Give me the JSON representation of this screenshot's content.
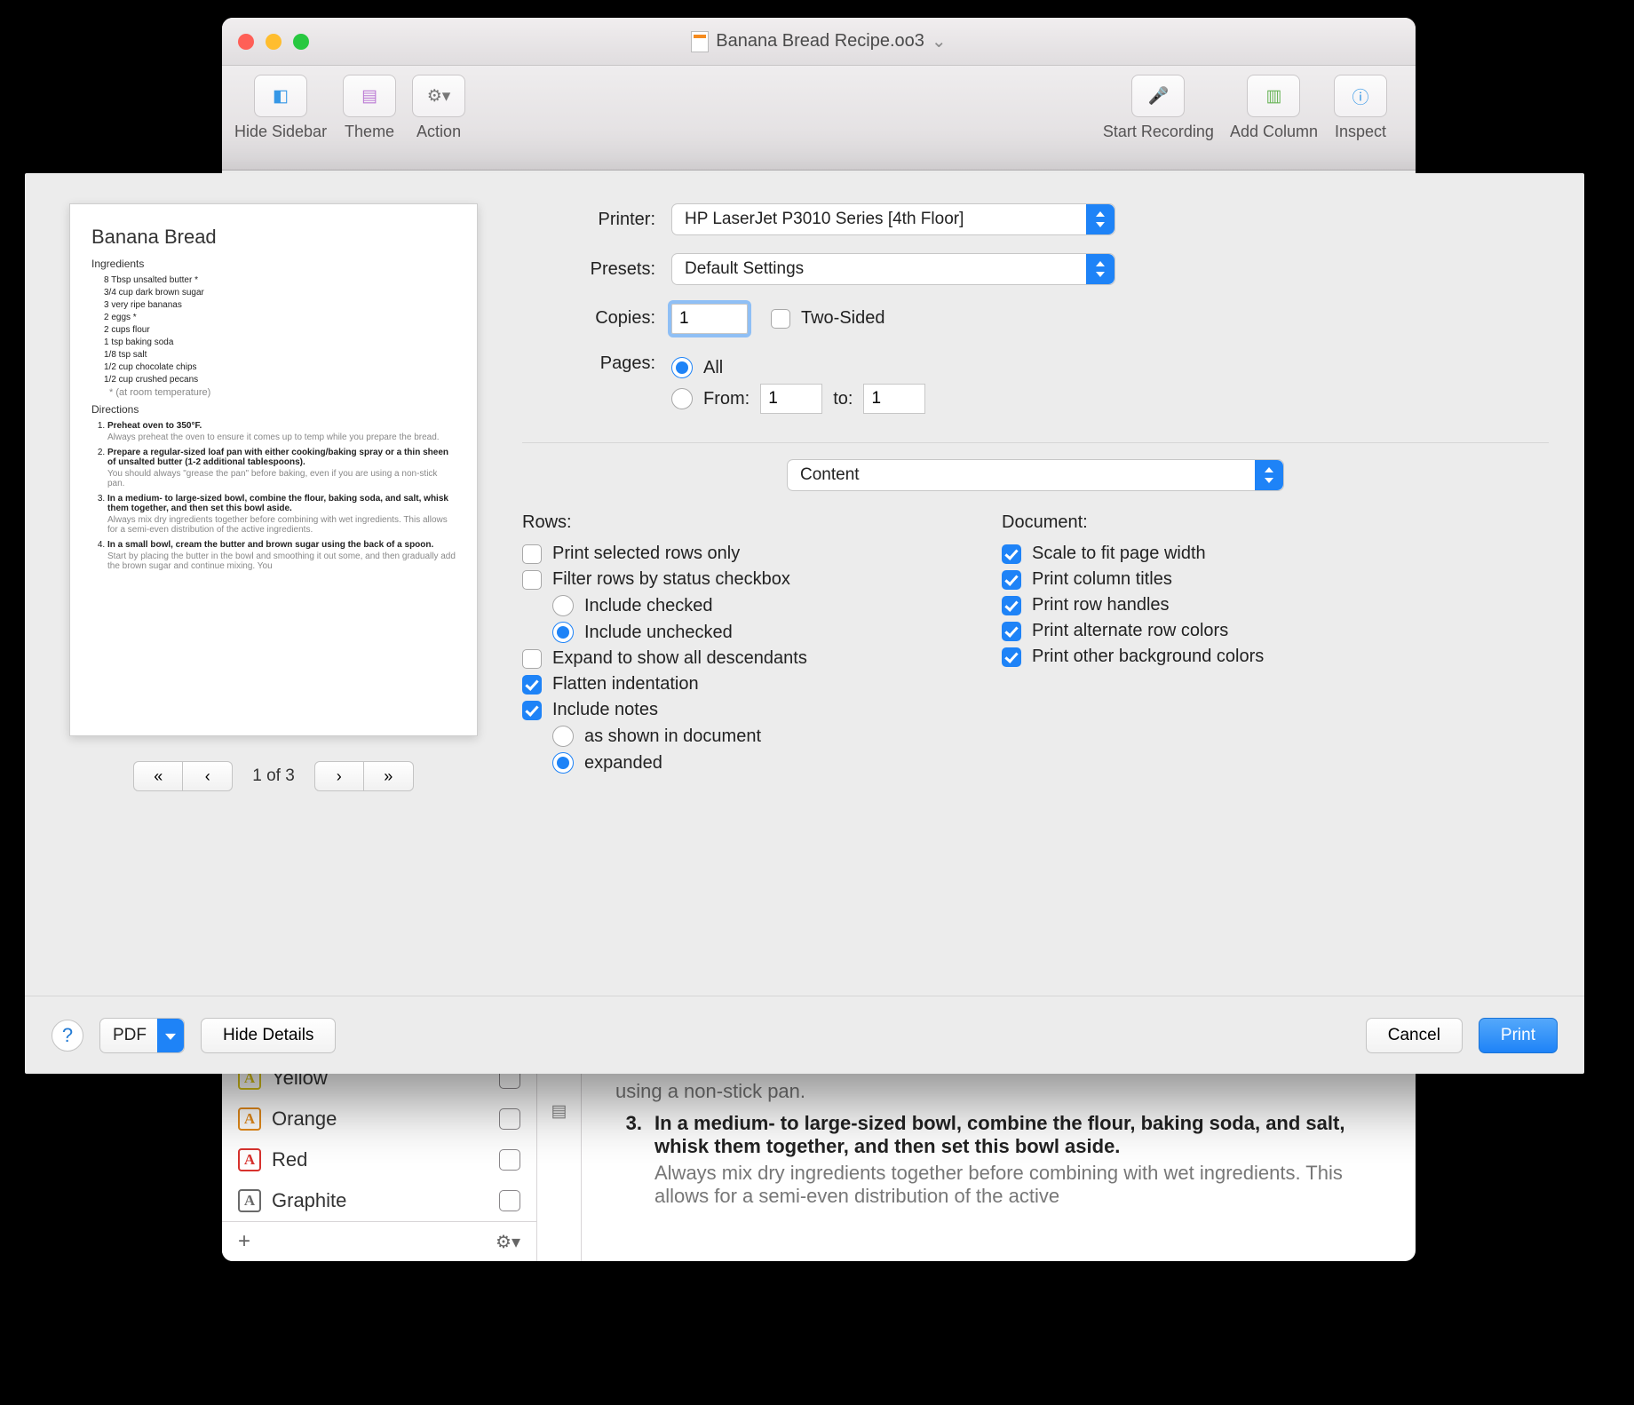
{
  "window": {
    "document_title": "Banana Bread Recipe.oo3",
    "toolbar": {
      "hide_sidebar": "Hide Sidebar",
      "theme": "Theme",
      "action": "Action",
      "start_recording": "Start Recording",
      "add_column": "Add Column",
      "inspect": "Inspect"
    },
    "sidebar_tags": [
      {
        "letter": "A",
        "color": "#d8c219",
        "label": "Yellow"
      },
      {
        "letter": "A",
        "color": "#e38a1a",
        "label": "Orange"
      },
      {
        "letter": "A",
        "color": "#d8322e",
        "label": "Red"
      },
      {
        "letter": "A",
        "color": "#6a6a6a",
        "label": "Graphite"
      }
    ],
    "doc_snippets": {
      "prev_tail": "using a non-stick pan.",
      "step3_num": "3.",
      "step3_headline": "In a medium- to large-sized bowl, combine the flour, baking soda, and salt, whisk them together, and then set this bowl aside.",
      "step3_note": "Always mix dry ingredients together before combining with wet ingredients. This allows for a semi-even distribution of the active"
    }
  },
  "print": {
    "labels": {
      "printer": "Printer:",
      "presets": "Presets:",
      "copies": "Copies:",
      "two_sided": "Two-Sided",
      "pages": "Pages:",
      "all": "All",
      "from": "From:",
      "to": "to:",
      "pane": "Content",
      "rows": "Rows:",
      "document": "Document:",
      "pdf": "PDF",
      "hide_details": "Hide Details",
      "cancel": "Cancel",
      "print": "Print",
      "page": "1 of 3"
    },
    "printer_value": "HP LaserJet P3010 Series [4th Floor]",
    "preset_value": "Default Settings",
    "copies_value": "1",
    "from_value": "1",
    "to_value": "1",
    "rows_options": {
      "selected_only": "Print selected rows only",
      "filter_status": "Filter rows by status checkbox",
      "include_checked": "Include checked",
      "include_unchecked": "Include unchecked",
      "expand_desc": "Expand to show all descendants",
      "flatten": "Flatten indentation",
      "include_notes": "Include notes",
      "notes_as_shown": "as shown in document",
      "notes_expanded": "expanded"
    },
    "doc_options": {
      "scale": "Scale to fit page width",
      "col_titles": "Print column titles",
      "row_handles": "Print row handles",
      "alt_rows": "Print alternate row colors",
      "other_bg": "Print other background colors"
    },
    "preview": {
      "title": "Banana Bread",
      "sec_ingredients": "Ingredients",
      "ingredients": [
        "8 Tbsp unsalted butter *",
        "3/4 cup dark brown sugar",
        "3 very ripe bananas",
        "2 eggs *",
        "2 cups flour",
        "1 tsp baking soda",
        "1/8 tsp salt",
        "1/2 cup chocolate chips",
        "1/2 cup crushed pecans"
      ],
      "ing_note": "* (at room temperature)",
      "sec_directions": "Directions",
      "steps": [
        {
          "h": "Preheat oven to 350°F.",
          "n": "Always preheat the oven to ensure it comes up to temp while you prepare the bread."
        },
        {
          "h": "Prepare a regular-sized loaf pan with either cooking/baking spray or a thin sheen of unsalted butter (1-2 additional tablespoons).",
          "n": "You should always \"grease the pan\" before baking, even if you are using a non-stick pan."
        },
        {
          "h": "In a medium- to large-sized bowl, combine the flour, baking soda, and salt, whisk them together, and then set this bowl aside.",
          "n": "Always mix dry ingredients together before combining with wet ingredients. This allows for a semi-even distribution of the active ingredients."
        },
        {
          "h": "In a small bowl, cream the butter and brown sugar using the back of a spoon.",
          "n": "Start by placing the butter in the bowl and smoothing it out some, and then gradually add the brown sugar and continue mixing. You"
        }
      ]
    }
  }
}
